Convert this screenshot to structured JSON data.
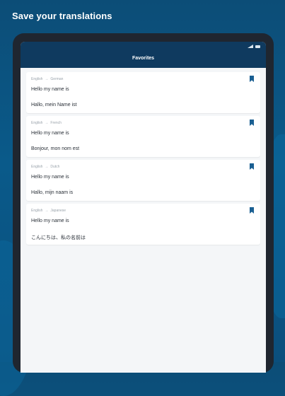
{
  "headline": "Save your translations",
  "app": {
    "title": "Favorites"
  },
  "favorites": [
    {
      "from": "English",
      "arrow": "→",
      "to": "German",
      "source": "Hello my name is",
      "translation": "Hallo, mein Name ist"
    },
    {
      "from": "English",
      "arrow": "→",
      "to": "French",
      "source": "Hello my name is",
      "translation": "Bonjour, mon nom est"
    },
    {
      "from": "English",
      "arrow": "→",
      "to": "Dutch",
      "source": "Hello my name is",
      "translation": "Hallo, mijn naam is"
    },
    {
      "from": "English",
      "arrow": "→",
      "to": "Japanese",
      "source": "Hello my name is",
      "translation": "こんにちは、私の名前は"
    }
  ],
  "colors": {
    "bookmark": "#1a5f92",
    "appbar": "#0f3a5f",
    "background": "#0c4d77"
  },
  "icons": {
    "bookmark": "bookmark-icon",
    "signal": "signal-icon",
    "battery": "battery-icon"
  }
}
